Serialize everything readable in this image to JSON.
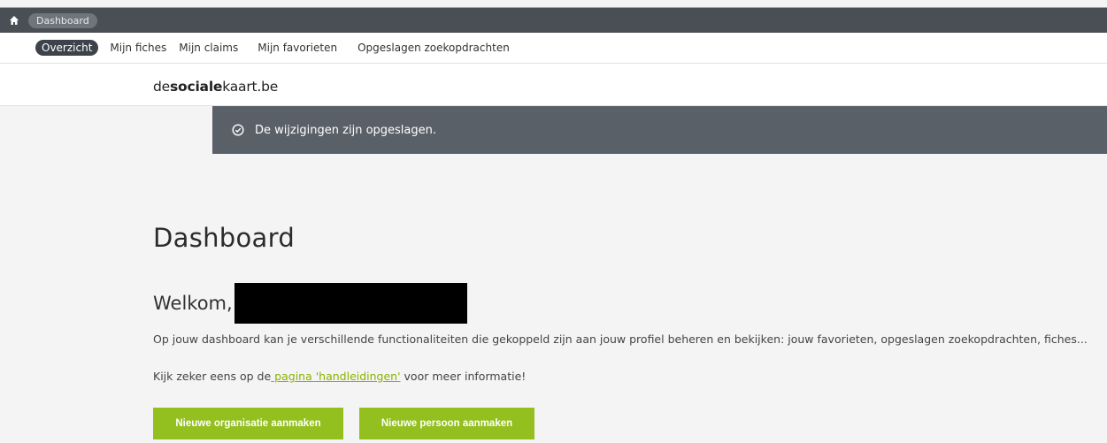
{
  "topbar": {
    "home_icon": "home-icon",
    "breadcrumb": "Dashboard"
  },
  "subnav": {
    "tabs": [
      {
        "label": "Overzicht",
        "active": true
      },
      {
        "label": "Mijn fiches"
      },
      {
        "label": "Mijn claims"
      },
      {
        "label": "Mijn favorieten"
      },
      {
        "label": "Opgeslagen zoekopdrachten"
      }
    ]
  },
  "brand": {
    "prefix": "de",
    "bold": "sociale",
    "suffix": "kaart.be"
  },
  "toast": {
    "icon": "check-circle-icon",
    "message": "De wijzigingen zijn opgeslagen."
  },
  "main": {
    "title": "Dashboard",
    "welcome": "Welkom,",
    "intro": "Op jouw dashboard kan je verschillende functionaliteiten die gekoppeld zijn aan jouw profiel beheren en bekijken: jouw favorieten, opgeslagen zoekopdrachten, fiches...",
    "info_prefix": "Kijk zeker eens op de",
    "info_link": " pagina 'handleidingen'",
    "info_suffix": " voor meer informatie!",
    "buttons": {
      "new_org": "Nieuwe organisatie aanmaken",
      "new_person": "Nieuwe persoon aanmaken"
    }
  },
  "colors": {
    "accent_green": "#93c01f",
    "link_green": "#8ab300",
    "topbar": "#4a4f55",
    "toast": "#5a6068"
  }
}
